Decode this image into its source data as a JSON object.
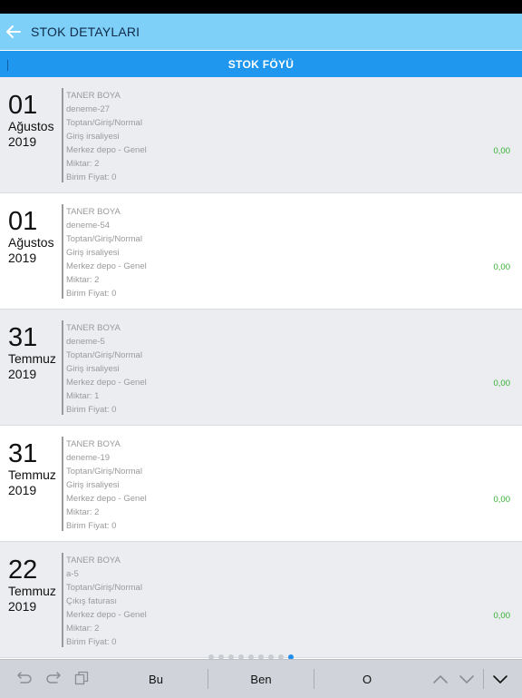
{
  "nav": {
    "title": "STOK DETAYLARI",
    "back_icon": "arrow-left-icon"
  },
  "tabs": {
    "active_label": "STOK FÖYÜ"
  },
  "rows": [
    {
      "day": "01",
      "month": "Ağustos",
      "year": "2019",
      "customer": "TANER BOYA",
      "doc": "deneme-27",
      "type": "Toptan/Giriş/Normal",
      "invoice": "Giriş irsaliyesi",
      "warehouse": "Merkez depo - Genel",
      "qty": "Miktar: 2",
      "price": "Birim Fiyat: 0",
      "amount": "0,00"
    },
    {
      "day": "01",
      "month": "Ağustos",
      "year": "2019",
      "customer": "TANER BOYA",
      "doc": "deneme-54",
      "type": "Toptan/Giriş/Normal",
      "invoice": "Giriş irsaliyesi",
      "warehouse": "Merkez depo - Genel",
      "qty": "Miktar: 2",
      "price": "Birim Fiyat: 0",
      "amount": "0,00"
    },
    {
      "day": "31",
      "month": "Temmuz",
      "year": "2019",
      "customer": "TANER BOYA",
      "doc": "deneme-5",
      "type": "Toptan/Giriş/Normal",
      "invoice": "Giriş irsaliyesi",
      "warehouse": "Merkez depo - Genel",
      "qty": "Miktar: 1",
      "price": "Birim Fiyat: 0",
      "amount": "0,00"
    },
    {
      "day": "31",
      "month": "Temmuz",
      "year": "2019",
      "customer": "TANER BOYA",
      "doc": "deneme-19",
      "type": "Toptan/Giriş/Normal",
      "invoice": "Giriş irsaliyesi",
      "warehouse": "Merkez depo - Genel",
      "qty": "Miktar: 2",
      "price": "Birim Fiyat: 0",
      "amount": "0,00"
    },
    {
      "day": "22",
      "month": "Temmuz",
      "year": "2019",
      "customer": "TANER BOYA",
      "doc": "a-5",
      "type": "Toptan/Giriş/Normal",
      "invoice": "Çıkış faturası",
      "warehouse": "Merkez depo - Genel",
      "qty": "Miktar: 2",
      "price": "Birim Fiyat: 0",
      "amount": "0,00"
    }
  ],
  "pagination": {
    "active_index": 8
  },
  "keyboard": {
    "suggestions": [
      "Bu",
      "Ben",
      "O"
    ],
    "icons": [
      "undo-icon",
      "redo-icon",
      "paste-icon",
      "chevron-up-icon",
      "chevron-down-icon",
      "dismiss-keyboard-icon"
    ]
  },
  "colors": {
    "nav_bg": "#7fd0f8",
    "tab_bg": "#1f97ee",
    "amount": "#35b035",
    "shaded_row": "#ebedf0"
  }
}
